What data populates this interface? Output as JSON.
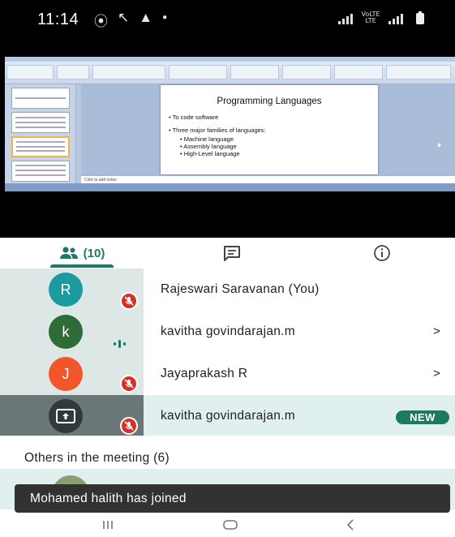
{
  "status_bar": {
    "time": "11:14",
    "left_icons": [
      "teams-icon",
      "missed-call-icon",
      "warning-icon",
      "dot-icon"
    ],
    "network_label": "VoLTE LTE"
  },
  "presentation": {
    "slide_title": "Programming Languages",
    "bullets": [
      "To code software",
      "Three major families of languages:"
    ],
    "sub_bullets": [
      "Machine language",
      "Assembly language",
      "High-Level language"
    ],
    "notes_placeholder": "Click to add notes"
  },
  "tabs": {
    "people_count": "(10)",
    "items": [
      "people-tab",
      "chat-tab",
      "info-tab"
    ]
  },
  "participants": [
    {
      "initial": "R",
      "name": "Rajeswari Saravanan (You)",
      "color": "#1b9aa0",
      "muted": true
    },
    {
      "initial": "k",
      "name": "kavitha govindarajan.m",
      "color": "#2e6b37",
      "speaking": true,
      "chevron": ">"
    },
    {
      "initial": "J",
      "name": "Jayaprakash R",
      "color": "#f0562a",
      "muted": true,
      "chevron": ">"
    },
    {
      "initial": "",
      "name": "kavitha govindarajan.m",
      "presenting": true,
      "muted": true,
      "badge": "NEW"
    }
  ],
  "others_heading": "Others in the meeting (6)",
  "toast": "Mohamed halith has joined",
  "colors": {
    "accent": "#1f7868",
    "mute_red": "#d93025",
    "highlight": "#dff0ee",
    "new_badge": "#1e7a5a"
  },
  "nav_buttons": [
    "recent-apps-button",
    "home-button",
    "back-button"
  ]
}
